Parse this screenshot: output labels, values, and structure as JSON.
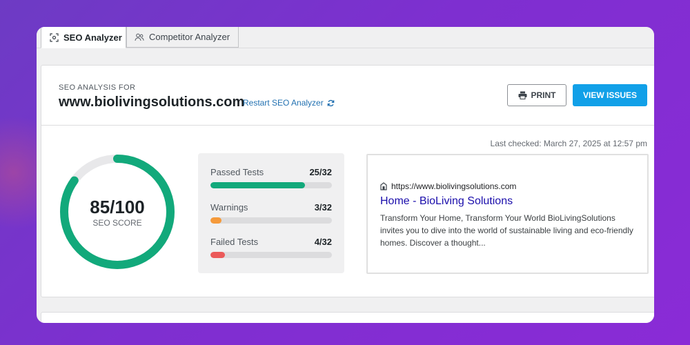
{
  "tabs": [
    {
      "label": "SEO Analyzer",
      "icon": "scan-icon",
      "active": true
    },
    {
      "label": "Competitor Analyzer",
      "icon": "users-icon",
      "active": false
    }
  ],
  "header": {
    "eyebrow": "SEO ANALYSIS FOR",
    "domain": "www.biolivingsolutions.com",
    "restart_label": "Restart SEO Analyzer",
    "print_label": "PRINT",
    "view_issues_label": "VIEW ISSUES"
  },
  "last_checked": "Last checked: March 27, 2025 at 12:57 pm",
  "score": {
    "value_text": "85/100",
    "label": "SEO SCORE",
    "value": 85,
    "max": 100,
    "color": "#12a97b",
    "track_color": "#e8e8ea"
  },
  "stats": [
    {
      "label": "Passed Tests",
      "value_text": "25/32",
      "fraction": 0.78,
      "color": "#12a97b"
    },
    {
      "label": "Warnings",
      "value_text": "3/32",
      "fraction": 0.09,
      "color": "#f59a3b"
    },
    {
      "label": "Failed Tests",
      "value_text": "4/32",
      "fraction": 0.12,
      "color": "#eb5a5a"
    }
  ],
  "preview": {
    "url": "https://www.biolivingsolutions.com",
    "title": "Home - BioLiving Solutions",
    "description": "Transform Your Home, Transform Your World BioLivingSolutions invites you to dive into the world of sustainable living and eco-friendly homes. Discover a thought..."
  },
  "colors": {
    "accent": "#11a0e8",
    "link": "#2271b1",
    "serp_title": "#1a0dab"
  }
}
